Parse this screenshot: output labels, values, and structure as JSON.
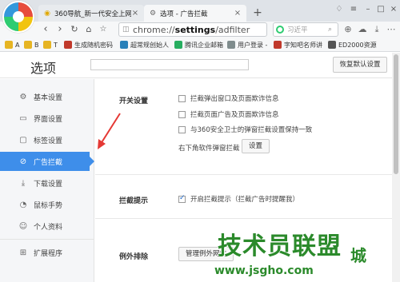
{
  "tabs": [
    {
      "title": "360导航_新一代安全上网导航",
      "favicon": "360-icon",
      "active": false
    },
    {
      "title": "选项 - 广告拦截",
      "favicon": "gear-icon",
      "active": true
    }
  ],
  "nav": {
    "url_prefix": "chrome://",
    "url_host": "settings",
    "url_path": "/adfilter",
    "search_placeholder": "习近平"
  },
  "bookmarks": [
    {
      "label": "A",
      "color": "#d35400"
    },
    {
      "label": "B",
      "color": "#e0a800"
    },
    {
      "label": "T",
      "color": "#e0a800"
    },
    {
      "label": "生成随机密码",
      "color": "#c0392b"
    },
    {
      "label": "超常规创始人",
      "color": "#2980b9"
    },
    {
      "label": "腾讯企业邮箱",
      "color": "#27ae60"
    },
    {
      "label": "用户登录 -",
      "color": "#7f8c8d"
    },
    {
      "label": "字知吧名师讲",
      "color": "#c0392b"
    },
    {
      "label": "ED2000资源",
      "color": "#555555"
    }
  ],
  "page": {
    "title": "选项",
    "reset_button": "恢复默认设置"
  },
  "sidebar": {
    "items": [
      {
        "label": "基本设置",
        "icon": "⚙",
        "name": "sidebar-item-basic"
      },
      {
        "label": "界面设置",
        "icon": "▭",
        "name": "sidebar-item-interface"
      },
      {
        "label": "标签设置",
        "icon": "▢",
        "name": "sidebar-item-tabs"
      },
      {
        "label": "广告拦截",
        "icon": "⊘",
        "name": "sidebar-item-adblock"
      },
      {
        "label": "下载设置",
        "icon": "⤓",
        "name": "sidebar-item-download"
      },
      {
        "label": "鼠标手势",
        "icon": "◔",
        "name": "sidebar-item-gesture"
      },
      {
        "label": "个人资料",
        "icon": "☺",
        "name": "sidebar-item-profile"
      },
      {
        "label": "扩展程序",
        "icon": "⊞",
        "name": "sidebar-item-extensions"
      }
    ],
    "active_index": 3
  },
  "content": {
    "section1_title": "开关设置",
    "options": [
      {
        "label": "拦截弹出窗口及页面欺诈信息",
        "checked": false
      },
      {
        "label": "拦截页面广告及页面欺诈信息",
        "checked": false
      },
      {
        "label": "与360安全卫士的弹窗拦截设置保持一致",
        "checked": false
      }
    ],
    "popup_label": "右下角软件弹窗拦截",
    "popup_button": "设置",
    "section2_title": "拦截提示",
    "notify_option": {
      "label": "开启拦截提示（拦截广告时提醒我）",
      "checked": true
    },
    "section3_title": "例外排除",
    "manage_button": "管理例外网站"
  },
  "watermark": {
    "text": "技术员联盟",
    "side": "城",
    "url": "www.jsgho.com"
  },
  "colors": {
    "accent": "#3e8eea",
    "arrow": "#e53935",
    "watermark": "#2b8a2b"
  }
}
